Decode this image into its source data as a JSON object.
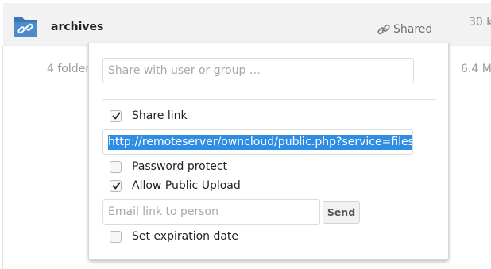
{
  "file_row": {
    "name": "archives",
    "share_status": "Shared",
    "size": "30 k"
  },
  "summary": {
    "folders": "4 folder",
    "size": "6.4 M"
  },
  "share_dropdown": {
    "share_with_placeholder": "Share with user or group …",
    "share_link_label": "Share link",
    "share_link_checked": true,
    "public_link": "http://remoteserver/owncloud/public.php?service=files&",
    "password_protect_label": "Password protect",
    "password_protect_checked": false,
    "allow_public_upload_label": "Allow Public Upload",
    "allow_public_upload_checked": true,
    "email_placeholder": "Email link to person",
    "send_label": "Send",
    "expiration_label": "Set expiration date",
    "expiration_checked": false
  },
  "colors": {
    "selection_highlight": "#2f8de4",
    "folder_icon": "#3a78b5",
    "row_background": "#f2f2f2"
  },
  "icons": {
    "folder": "shared-folder-icon",
    "share": "link-icon",
    "check": "checkmark-icon"
  }
}
